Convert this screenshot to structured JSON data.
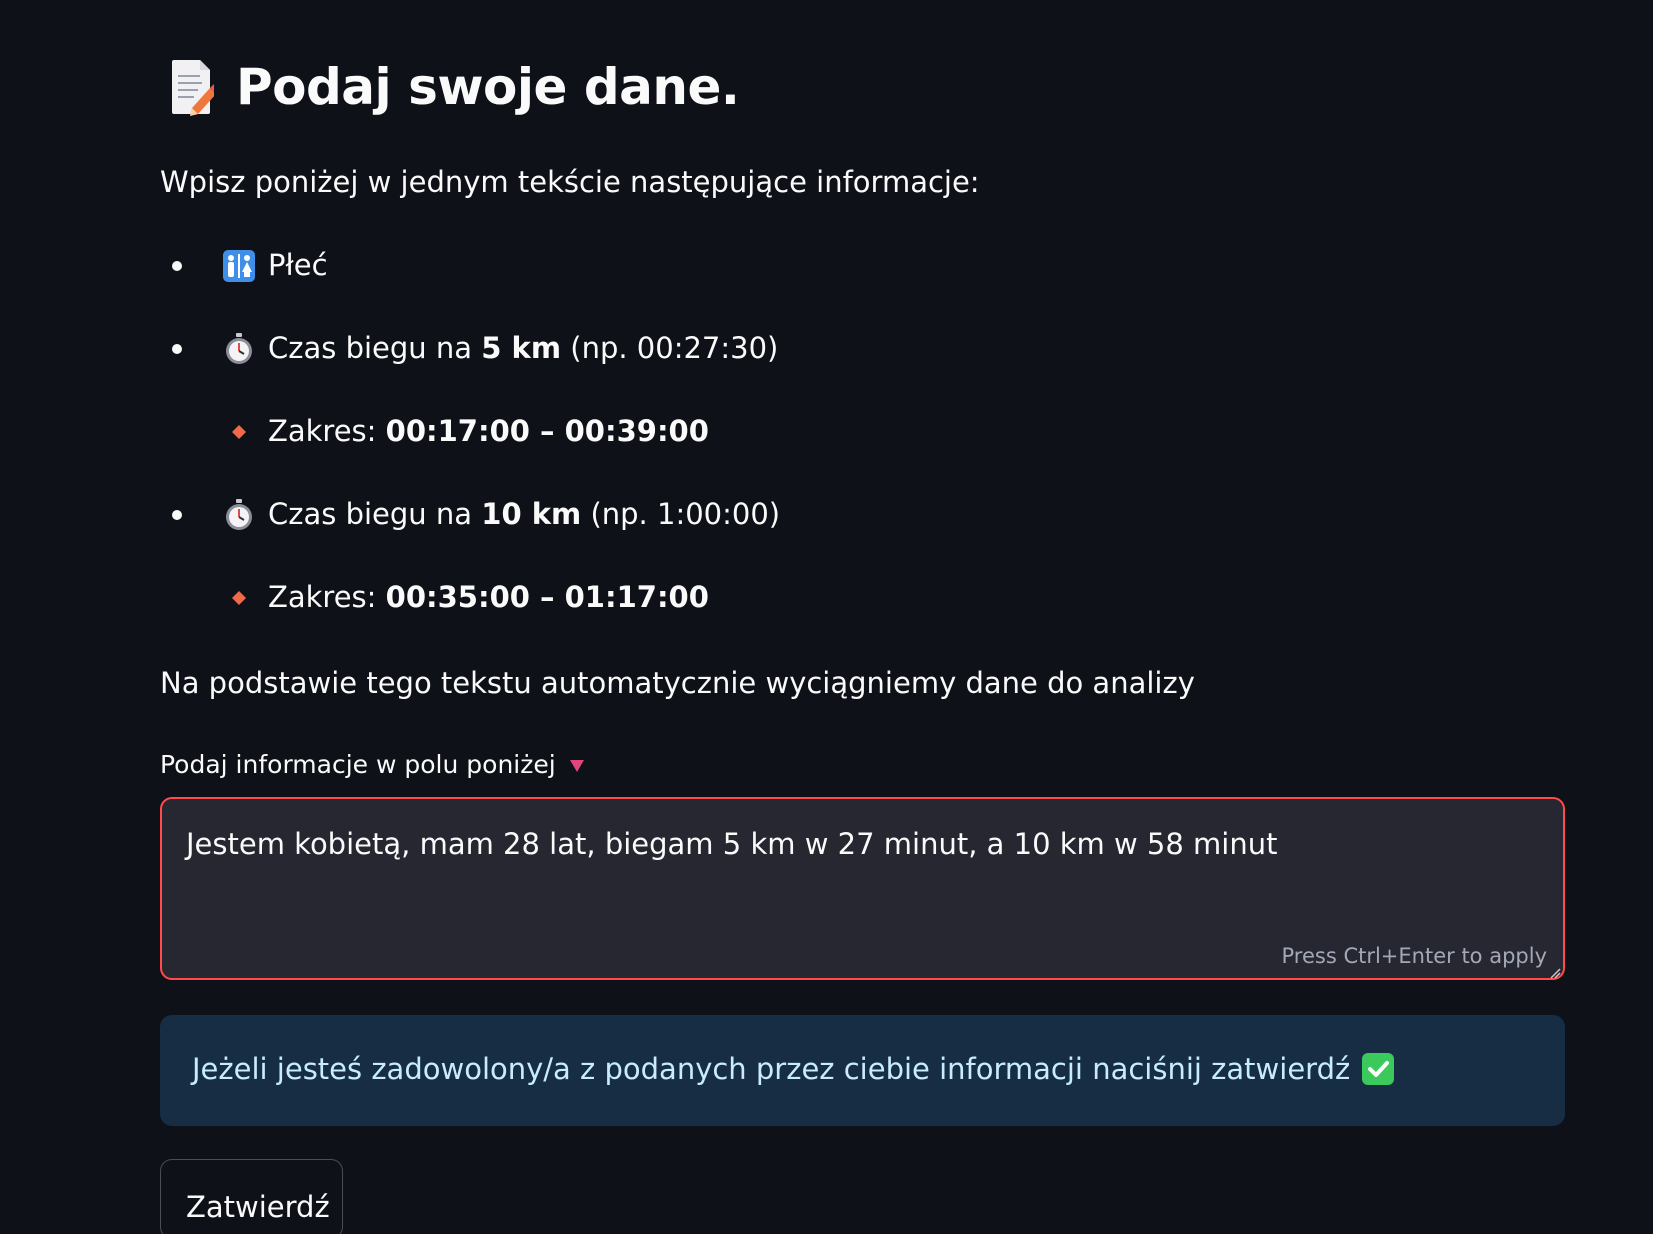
{
  "header": {
    "title": "Podaj swoje dane.",
    "icon": "memo-icon"
  },
  "instructions": {
    "intro": "Wpisz poniżej w jednym tekście następujące informacje:",
    "items": [
      {
        "icon": "restroom-icon",
        "text": "Płeć"
      },
      {
        "icon": "stopwatch-icon",
        "prefix": "Czas biegu na ",
        "strong": "5 km",
        "suffix": " (np. 00:27:30)"
      },
      {
        "icon": "diamond-icon",
        "prefix": "Zakres: ",
        "strong": "00:17:00 – 00:39:00"
      },
      {
        "icon": "stopwatch-icon",
        "prefix": "Czas biegu na ",
        "strong": "10 km",
        "suffix": " (np. 1:00:00)"
      },
      {
        "icon": "diamond-icon",
        "prefix": "Zakres: ",
        "strong": "00:35:00 – 01:17:00"
      }
    ],
    "note": "Na podstawie tego tekstu automatycznie wyciągniemy dane do analizy"
  },
  "form": {
    "label": "Podaj informacje w polu poniżej",
    "value": "Jestem kobietą, mam 28 lat, biegam 5 km w 27 minut, a 10 km w 58 minut",
    "hint": "Press Ctrl+Enter to apply"
  },
  "info": {
    "text": "Jeżeli jesteś zadowolony/a z podanych przez ciebie informacji naciśnij zatwierdź"
  },
  "actions": {
    "submit_label": "Zatwierdź"
  },
  "colors": {
    "background": "#0e1117",
    "text": "#fafafa",
    "input_border": "#ff4b4b",
    "input_background": "#262730",
    "info_background": "#172d43",
    "info_text": "#c7ebff",
    "diamond": "#f06a4a",
    "label_arrow": "#e0457b"
  }
}
